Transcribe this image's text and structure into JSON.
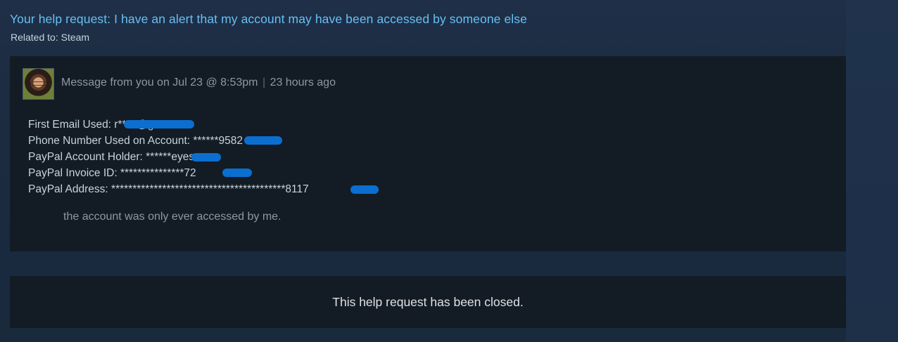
{
  "request": {
    "title": "Your help request: I have an alert that my account may have been accessed by someone else",
    "related_label": "Related to:",
    "related_value": "Steam"
  },
  "message": {
    "header_prefix": "Message from you on Jul 23 @ 8:53pm",
    "header_separator": "|",
    "header_relative": "23 hours ago",
    "lines": [
      "First Email Used: r***5@g***n",
      "Phone Number Used on Account: ******9582",
      "PayPal Account Holder: ******eyes",
      "PayPal Invoice ID: ***************72",
      "PayPal Address: *****************************************8117"
    ],
    "note": "the account was only ever accessed by me."
  },
  "status": {
    "closed_text": "This help request has been closed."
  },
  "colors": {
    "link": "#66c0f4",
    "redaction": "#0a6fd0",
    "card_bg": "#131b24"
  },
  "icons": {
    "avatar": "user-avatar-photo"
  }
}
